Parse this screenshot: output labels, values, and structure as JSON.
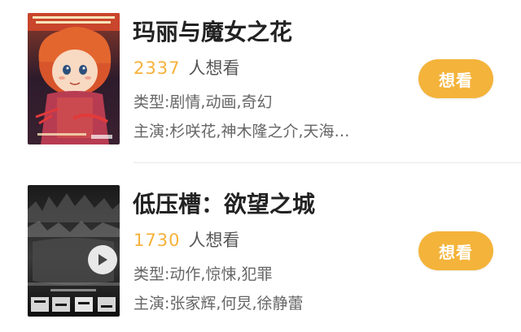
{
  "movies": [
    {
      "title": "玛丽与魔女之花",
      "want_count": "2337",
      "want_label": "人想看",
      "genre": "类型:剧情,动画,奇幻",
      "cast": "主演:杉咲花,神木隆之介,天海…",
      "button_label": "想看",
      "has_play_icon": false,
      "poster_icon": "movie-poster"
    },
    {
      "title": "低压槽：欲望之城",
      "want_count": "1730",
      "want_label": "人想看",
      "genre": "类型:动作,惊悚,犯罪",
      "cast": "主演:张家辉,何炅,徐静蕾",
      "button_label": "想看",
      "has_play_icon": true,
      "poster_icon": "movie-poster"
    }
  ],
  "colors": {
    "accent": "#f4b33a",
    "count": "#f6b13a",
    "title": "#222222",
    "meta": "#666666",
    "divider": "#e9e9e9"
  }
}
